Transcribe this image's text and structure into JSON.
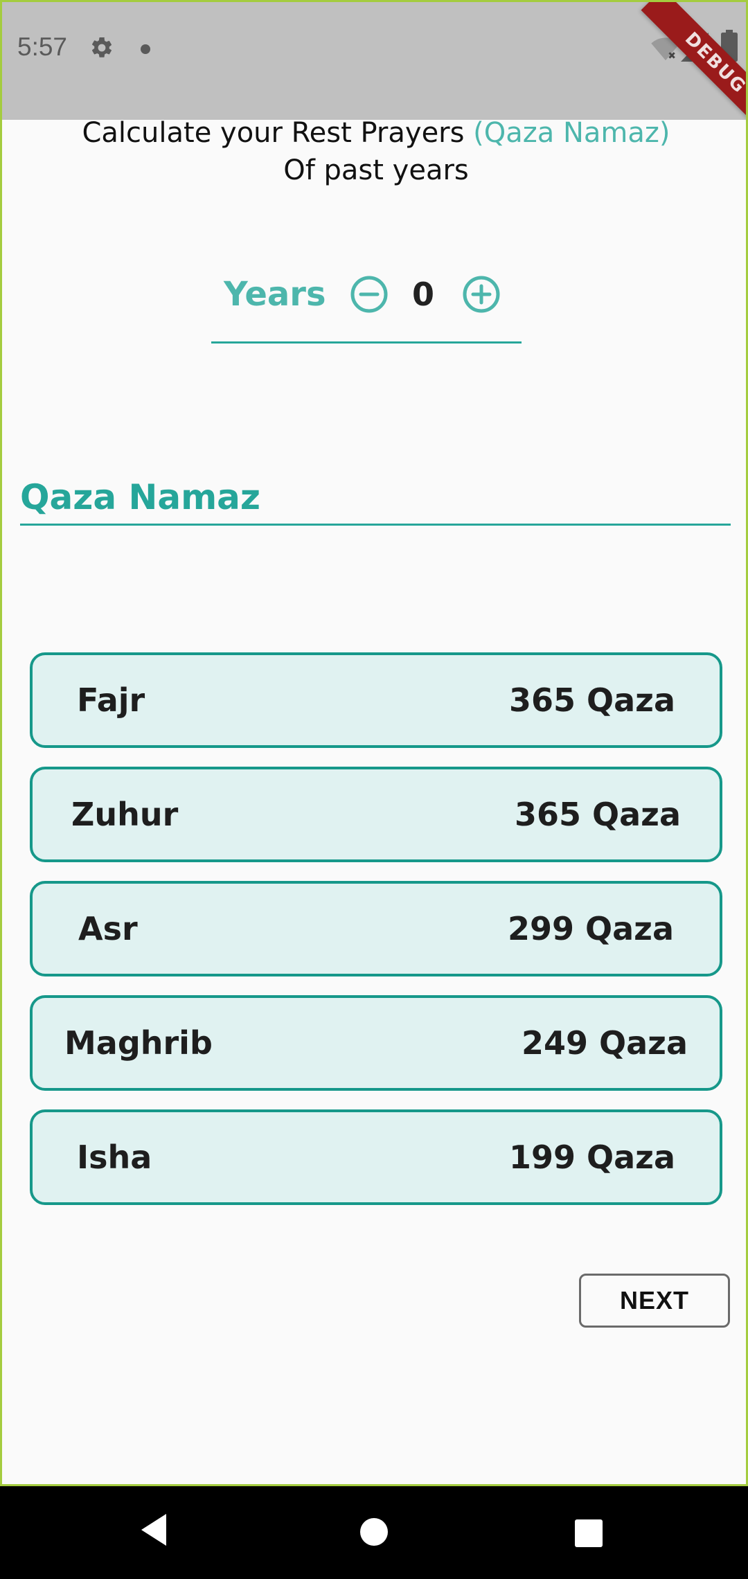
{
  "status_bar": {
    "time": "5:57",
    "icons": [
      "gear-icon",
      "notification-dot-icon",
      "wifi-off-icon",
      "cell-signal-icon",
      "battery-icon"
    ]
  },
  "debug_banner": {
    "label": "DEBUG",
    "color": "#9a1b1b"
  },
  "heading": {
    "line1_prefix": "Calculate your Rest Prayers ",
    "line1_accent": "(Qaza Namaz)",
    "line2": "Of past years"
  },
  "years": {
    "label": "Years",
    "value": "0",
    "decrement_icon": "minus-circle-icon",
    "increment_icon": "plus-circle-icon"
  },
  "section": {
    "title": "Qaza Namaz"
  },
  "prayers": [
    {
      "name": "Fajr",
      "count": "365 Qaza"
    },
    {
      "name": "Zuhur",
      "count": "365 Qaza"
    },
    {
      "name": "Asr",
      "count": "299 Qaza"
    },
    {
      "name": "Maghrib",
      "count": "249 Qaza"
    },
    {
      "name": "Isha",
      "count": "199 Qaza"
    }
  ],
  "actions": {
    "next_label": "NEXT"
  },
  "navigation": {
    "icons": [
      "back-icon",
      "home-icon",
      "recents-icon"
    ]
  },
  "colors": {
    "accent": "#26a69a",
    "accent_light": "#4db6ac",
    "card_background": "#e0f2f1",
    "card_border": "#16988a",
    "status_bar": "#c0c0c0",
    "background": "#fafafa"
  }
}
